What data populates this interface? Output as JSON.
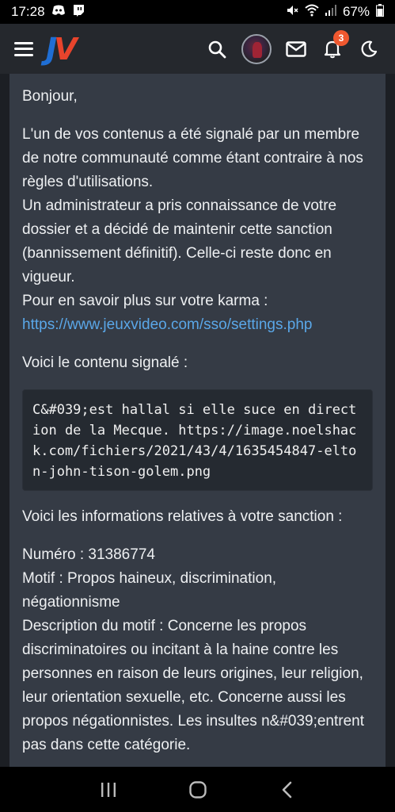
{
  "status_bar": {
    "time": "17:28",
    "battery": "67%"
  },
  "header": {
    "logo_j": "J",
    "logo_v": "V",
    "notification_count": "3"
  },
  "message": {
    "greeting": "Bonjour,",
    "para1_line1": "L'un de vos contenus a été signalé par un membre de notre communauté comme étant contraire à nos règles d'utilisations.",
    "para1_line2": "Un administrateur a pris connaissance de votre dossier et a décidé de maintenir cette sanction (bannissement définitif). Celle-ci reste donc en vigueur.",
    "para1_line3": "Pour en savoir plus sur votre karma :",
    "karma_link": "https://www.jeuxvideo.com/sso/settings.php",
    "reported_intro": "Voici le contenu signalé :",
    "reported_content": "C&#039;est hallal si elle suce en direction de la Mecque. https://image.noelshack.com/fichiers/2021/43/4/1635454847-elton-john-tison-golem.png",
    "sanction_intro": "Voici les informations relatives à votre sanction :",
    "numero": "Numéro : 31386774",
    "motif": "Motif : Propos haineux, discrimination, négationnisme",
    "description": "Description du motif : Concerne les propos discriminatoires ou incitant à la haine contre les personnes en raison de leurs origines, leur religion, leur orientation sexuelle, etc. Concerne aussi les propos négationnistes. Les insultes n&#039;entrent pas dans cette catégorie."
  }
}
